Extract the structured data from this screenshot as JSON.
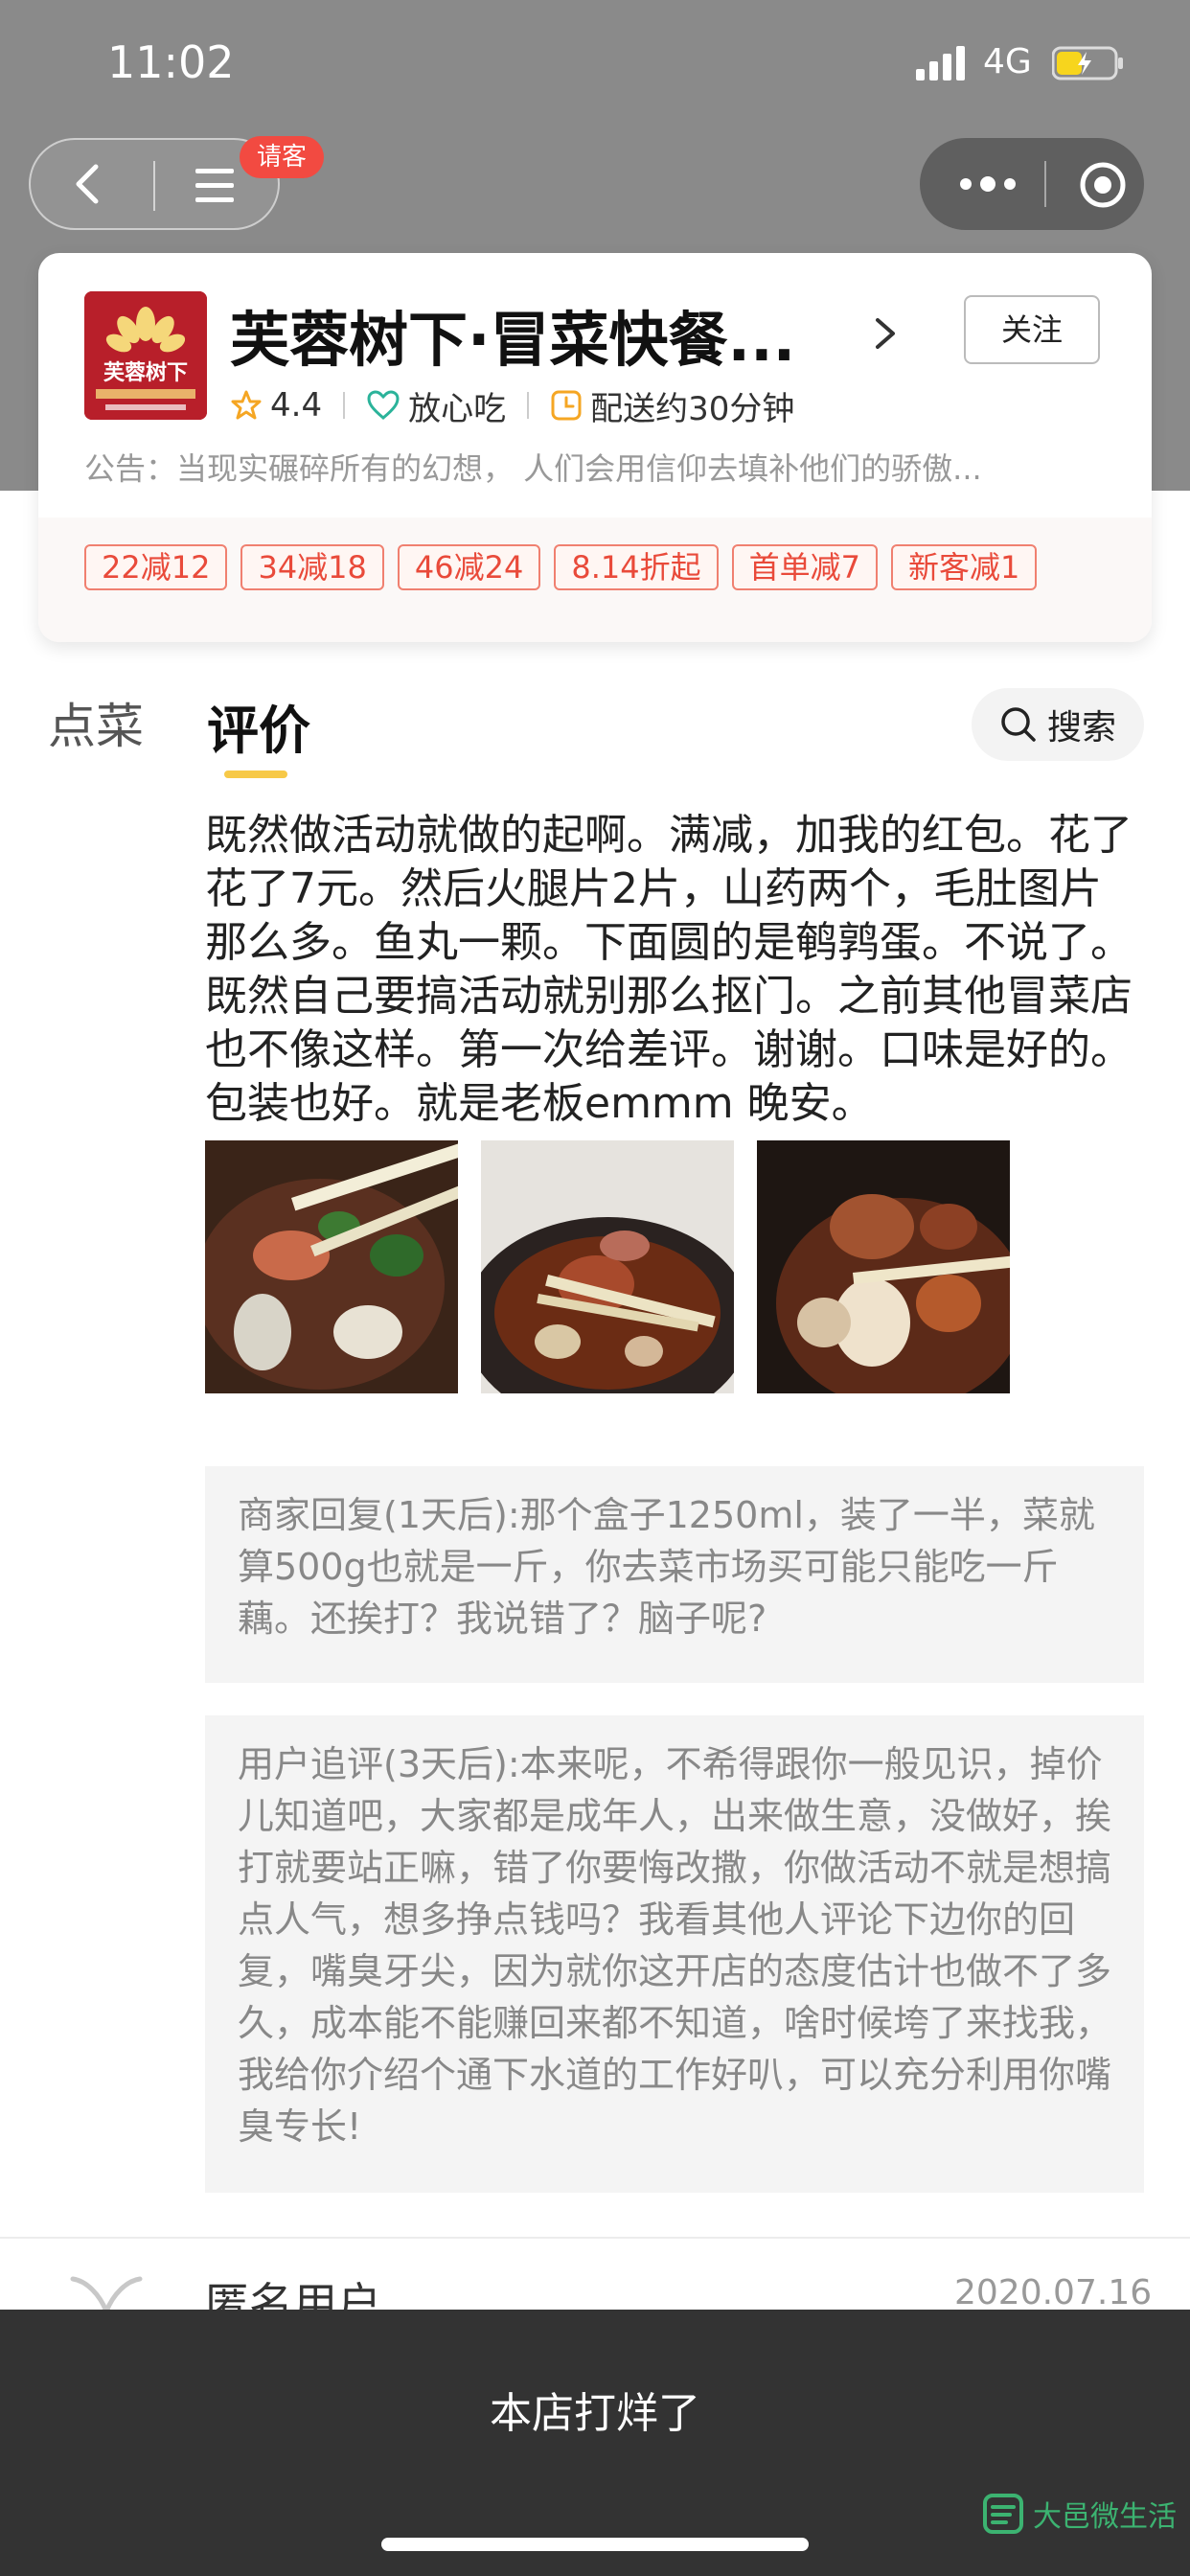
{
  "status": {
    "time": "11:02",
    "network": "4G"
  },
  "nav": {
    "invite_badge": "请客"
  },
  "store": {
    "logo_text": "芙蓉树下",
    "name": "芙蓉树下·冒菜快餐...",
    "follow_label": "关注",
    "rating": "4.4",
    "safe_label": "放心吃",
    "delivery": "配送约30分钟",
    "notice": "公告：当现实碾碎所有的幻想， 人们会用信仰去填补他们的骄傲..."
  },
  "promos": [
    "22减12",
    "34减18",
    "46减24",
    "8.14折起",
    "首单减7",
    "新客减1"
  ],
  "tabs": {
    "order": "点菜",
    "review": "评价",
    "search": "搜索"
  },
  "review": {
    "text": "既然做活动就做的起啊。满减，加我的红包。花了 花了7元。然后火腿片2片，山药两个，毛肚图片那么多。鱼丸一颗。下面圆的是鹌鹑蛋。不说了。既然自己要搞活动就别那么抠门。之前其他冒菜店也不像这样。第一次给差评。谢谢。口味是好的。包装也好。就是老板emmm 晚安。",
    "merchant_reply": "商家回复(1天后):那个盒子1250ml，装了一半，菜就算500g也就是一斤，你去菜市场买可能只能吃一斤藕。还挨打？我说错了？脑子呢?",
    "followup": "用户追评(3天后):本来呢，不希得跟你一般见识，掉价儿知道吧，大家都是成年人，出来做生意，没做好，挨打就要站正嘛，错了你要悔改撒，你做活动不就是想搞点人气，想多挣点钱吗？我看其他人评论下边你的回复，嘴臭牙尖，因为就你这开店的态度估计也做不了多久，成本能不能赚回来都不知道，啥时候垮了来找我，我给你介绍个通下水道的工作好叭，可以充分利用你嘴臭专长!"
  },
  "next_review": {
    "user": "匿名用户",
    "date": "2020.07.16"
  },
  "bottom": {
    "closed_text": "本店打烊了",
    "watermark": "大邑微生活"
  },
  "colors": {
    "accent": "#f7c948",
    "promo": "#e94a3a",
    "badge": "#f24a41"
  }
}
